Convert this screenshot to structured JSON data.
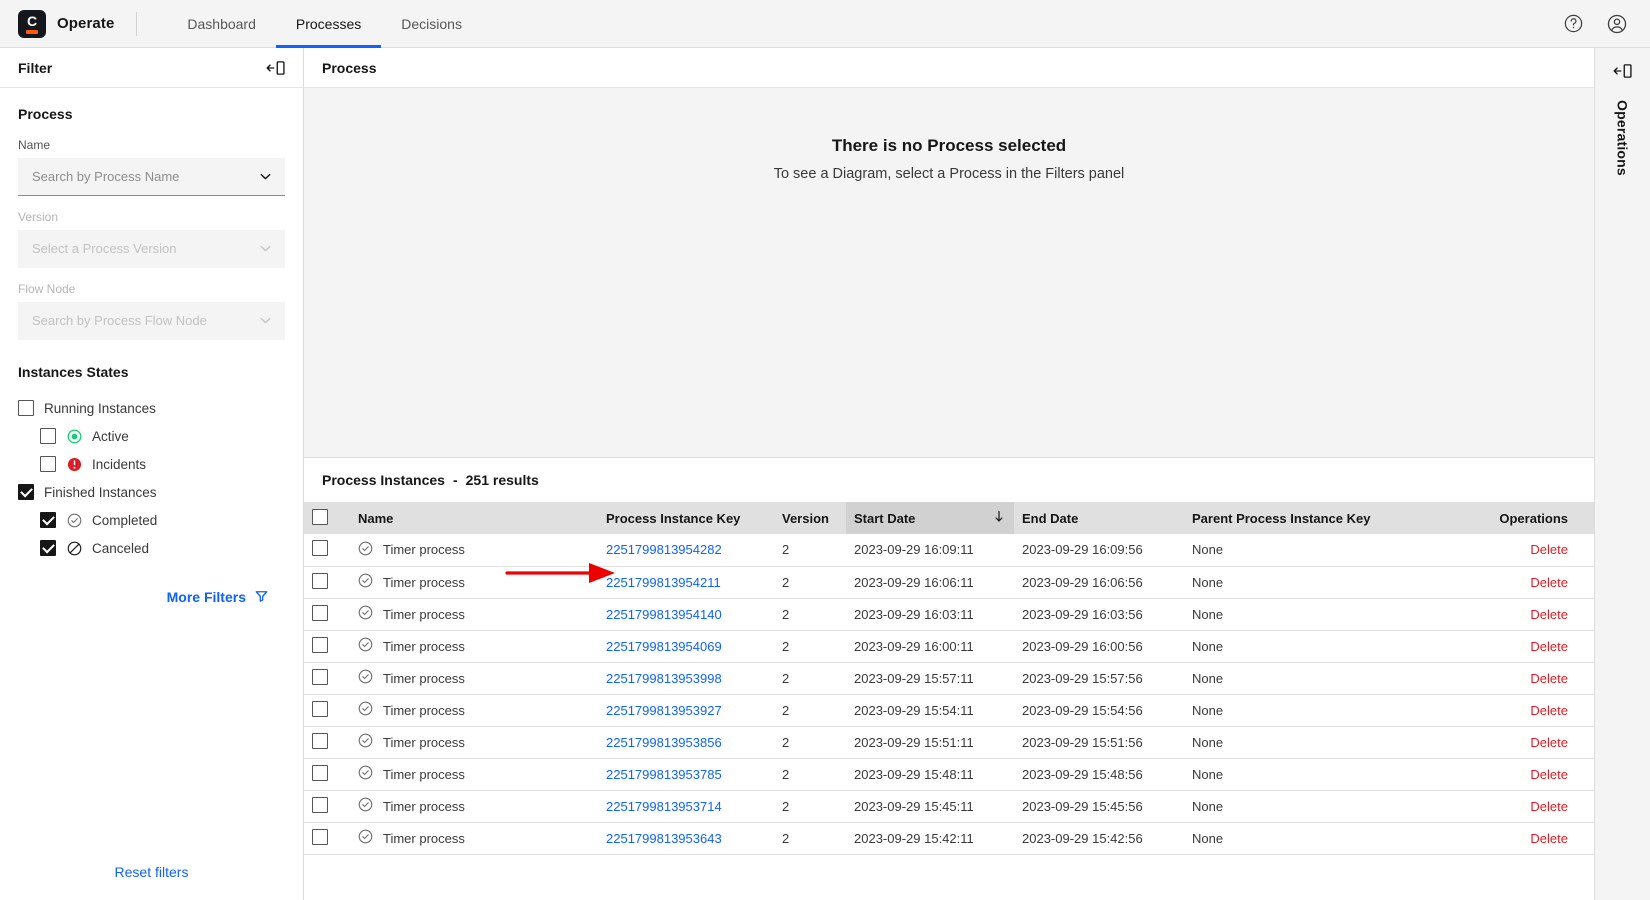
{
  "app": {
    "brand_name": "Operate",
    "logo_letter": "C"
  },
  "nav": {
    "items": [
      {
        "label": "Dashboard",
        "active": false
      },
      {
        "label": "Processes",
        "active": true
      },
      {
        "label": "Decisions",
        "active": false
      }
    ]
  },
  "topbar_icons": {
    "help": "help-icon",
    "user": "user-avatar-icon"
  },
  "filter_panel": {
    "title": "Filter",
    "collapse_icon": "collapse-panel-icon",
    "process_group_title": "Process",
    "fields": [
      {
        "label": "Name",
        "placeholder": "Search by Process Name",
        "value": "",
        "disabled": false
      },
      {
        "label": "Version",
        "placeholder": "Select a Process Version",
        "value": "",
        "disabled": true
      },
      {
        "label": "Flow Node",
        "placeholder": "Search by Process Flow Node",
        "value": "",
        "disabled": true
      }
    ],
    "states_title": "Instances States",
    "states": [
      {
        "label": "Running Instances",
        "checked": false,
        "indent": false,
        "icon": "none"
      },
      {
        "label": "Active",
        "checked": false,
        "indent": true,
        "icon": "active-icon"
      },
      {
        "label": "Incidents",
        "checked": false,
        "indent": true,
        "icon": "incident-icon"
      },
      {
        "label": "Finished Instances",
        "checked": true,
        "indent": false,
        "icon": "none"
      },
      {
        "label": "Completed",
        "checked": true,
        "indent": true,
        "icon": "completed-icon"
      },
      {
        "label": "Canceled",
        "checked": true,
        "indent": true,
        "icon": "canceled-icon"
      }
    ],
    "more_filters_label": "More Filters",
    "more_filters_icon": "filter-icon",
    "reset_filters_label": "Reset filters"
  },
  "diagram_panel": {
    "title": "Process",
    "empty_title": "There is no Process selected",
    "empty_subtitle": "To see a Diagram, select a Process in the Filters panel"
  },
  "instances_panel": {
    "title": "Process Instances",
    "separator": "-",
    "count_label": "251 results",
    "columns": [
      {
        "key": "name",
        "label": "Name",
        "sorted": false
      },
      {
        "key": "process_instance_key",
        "label": "Process Instance Key",
        "sorted": false
      },
      {
        "key": "version",
        "label": "Version",
        "sorted": false
      },
      {
        "key": "start_date",
        "label": "Start Date",
        "sorted": true,
        "sort_dir": "desc"
      },
      {
        "key": "end_date",
        "label": "End Date",
        "sorted": false
      },
      {
        "key": "parent_process_instance_key",
        "label": "Parent Process Instance Key",
        "sorted": false
      },
      {
        "key": "operations",
        "label": "Operations",
        "sorted": false
      }
    ],
    "delete_label": "Delete",
    "rows": [
      {
        "name": "Timer process",
        "key": "2251799813954282",
        "version": "2",
        "start": "2023-09-29 16:09:11",
        "end": "2023-09-29 16:09:56",
        "parent": "None"
      },
      {
        "name": "Timer process",
        "key": "2251799813954211",
        "version": "2",
        "start": "2023-09-29 16:06:11",
        "end": "2023-09-29 16:06:56",
        "parent": "None"
      },
      {
        "name": "Timer process",
        "key": "2251799813954140",
        "version": "2",
        "start": "2023-09-29 16:03:11",
        "end": "2023-09-29 16:03:56",
        "parent": "None"
      },
      {
        "name": "Timer process",
        "key": "2251799813954069",
        "version": "2",
        "start": "2023-09-29 16:00:11",
        "end": "2023-09-29 16:00:56",
        "parent": "None"
      },
      {
        "name": "Timer process",
        "key": "2251799813953998",
        "version": "2",
        "start": "2023-09-29 15:57:11",
        "end": "2023-09-29 15:57:56",
        "parent": "None"
      },
      {
        "name": "Timer process",
        "key": "2251799813953927",
        "version": "2",
        "start": "2023-09-29 15:54:11",
        "end": "2023-09-29 15:54:56",
        "parent": "None"
      },
      {
        "name": "Timer process",
        "key": "2251799813953856",
        "version": "2",
        "start": "2023-09-29 15:51:11",
        "end": "2023-09-29 15:51:56",
        "parent": "None"
      },
      {
        "name": "Timer process",
        "key": "2251799813953785",
        "version": "2",
        "start": "2023-09-29 15:48:11",
        "end": "2023-09-29 15:48:56",
        "parent": "None"
      },
      {
        "name": "Timer process",
        "key": "2251799813953714",
        "version": "2",
        "start": "2023-09-29 15:45:11",
        "end": "2023-09-29 15:45:56",
        "parent": "None"
      },
      {
        "name": "Timer process",
        "key": "2251799813953643",
        "version": "2",
        "start": "2023-09-29 15:42:11",
        "end": "2023-09-29 15:42:56",
        "parent": "None"
      }
    ]
  },
  "operations_rail": {
    "label": "Operations",
    "collapse_icon": "collapse-panel-icon"
  },
  "colors": {
    "accent_blue": "#0f62fe",
    "delete_red": "#da1e28",
    "active_green": "#10d070",
    "incident_red": "#da1e28",
    "brand_orange": "#fc5d0d",
    "annotation_red": "#ee0000"
  }
}
